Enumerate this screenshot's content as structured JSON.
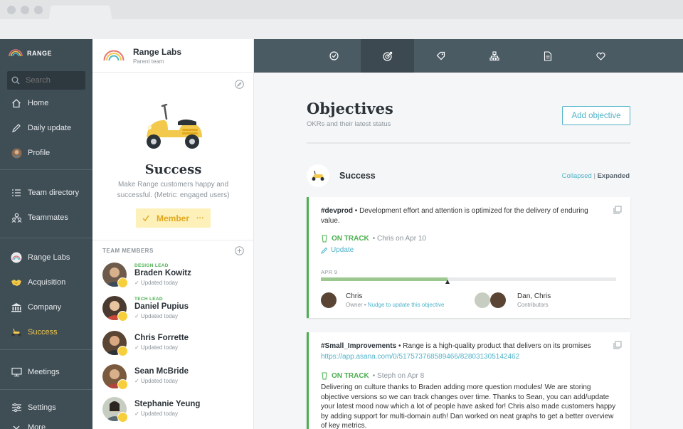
{
  "sidebar": {
    "brand": "RANGE",
    "search_placeholder": "Search",
    "items": [
      {
        "label": "Home",
        "icon": "home-icon"
      },
      {
        "label": "Daily update",
        "icon": "pencil-icon"
      },
      {
        "label": "Profile",
        "icon": "avatar"
      },
      {
        "label": "Team directory",
        "icon": "list-icon"
      },
      {
        "label": "Teammates",
        "icon": "people-icon"
      },
      {
        "label": "Range Labs",
        "icon": "rainbow-icon"
      },
      {
        "label": "Acquisition",
        "icon": "handshake-icon"
      },
      {
        "label": "Company",
        "icon": "building-icon"
      },
      {
        "label": "Success",
        "icon": "scooter-icon"
      },
      {
        "label": "Meetings",
        "icon": "monitor-icon"
      },
      {
        "label": "Settings",
        "icon": "sliders-icon"
      },
      {
        "label": "More",
        "icon": "chevron-down-icon"
      }
    ]
  },
  "team": {
    "name": "Range Labs",
    "subtitle": "Parent team",
    "title": "Success",
    "description": "Make Range customers happy and successful. (Metric: engaged users)",
    "member_button": "Member",
    "member_more": "···",
    "members_label": "TEAM MEMBERS",
    "members": [
      {
        "role": "DESIGN LEAD",
        "name": "Braden Kowitz",
        "updated": "✓ Updated today"
      },
      {
        "role": "TECH LEAD",
        "name": "Daniel Pupius",
        "updated": "✓ Updated today"
      },
      {
        "role": "",
        "name": "Chris Forrette",
        "updated": "✓ Updated today"
      },
      {
        "role": "",
        "name": "Sean McBride",
        "updated": "✓ Updated today"
      },
      {
        "role": "",
        "name": "Stephanie Yeung",
        "updated": "✓ Updated today"
      }
    ]
  },
  "topnav": {
    "tabs": [
      "check-circle-icon",
      "target-icon",
      "tag-icon",
      "org-chart-icon",
      "document-icon",
      "heart-icon"
    ],
    "active_index": 1
  },
  "main": {
    "title": "Objectives",
    "subtitle": "OKRs and their latest status",
    "add_button": "Add objective",
    "section_title": "Success",
    "view_collapsed": "Collapsed",
    "view_sep": " | ",
    "view_expanded": "Expanded",
    "card1": {
      "tag": "#devprod",
      "text": " • Development effort and attention is optimized for the delivery of enduring value.",
      "status": "ON TRACK",
      "status_by": "• Chris on Apr 10",
      "update_label": "Update",
      "progress_label": "APR 9",
      "progress_fraction": 0.43,
      "marker_fraction": 0.43,
      "owner_name": "Chris",
      "owner_role": "Owner",
      "owner_sep": " • ",
      "nudge": "Nudge to update this objective",
      "contributors_names": "Dan, Chris",
      "contributors_label": "Contributors"
    },
    "card2": {
      "tag": "#Small_Improvements",
      "text": " • Range is a high-quality product that delivers on its promises",
      "link": "https://app.asana.com/0/517573768589466/828031305142462",
      "status": "ON TRACK",
      "status_by": "• Steph on Apr 8",
      "body": "Delivering on culture thanks to Braden adding more question modules! We are storing objective versions so we can track changes over time. Thanks to Sean, you can add/update your latest mood now which a lot of people have asked for! Chris also made customers happy by adding support for multi-domain auth! Dan worked on neat graphs to get a better overview of key metrics."
    }
  },
  "colors": {
    "sidebar_bg": "#3f4d55",
    "topbar_bg": "#4b5b64",
    "accent": "#4fb3c9",
    "success_green": "#4caf50",
    "active_yellow": "#f2c94c"
  }
}
